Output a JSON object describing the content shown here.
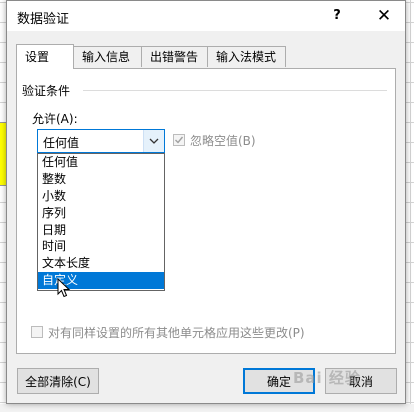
{
  "dialog": {
    "title": "数据验证",
    "help_label": "?",
    "close_label": "✕"
  },
  "tabs": [
    {
      "label": "设置",
      "active": true
    },
    {
      "label": "输入信息",
      "active": false
    },
    {
      "label": "出错警告",
      "active": false
    },
    {
      "label": "输入法模式",
      "active": false
    }
  ],
  "settings": {
    "group_label": "验证条件",
    "allow_label": "允许(A):",
    "allow_value": "任何值",
    "allow_options": [
      "任何值",
      "整数",
      "小数",
      "序列",
      "日期",
      "时间",
      "文本长度",
      "自定义"
    ],
    "selected_option": "自定义",
    "ignore_blank_label": "忽略空值(B)",
    "apply_all_label": "对有同样设置的所有其他单元格应用这些更改(P)"
  },
  "buttons": {
    "clear_all": "全部清除(C)",
    "ok": "确定",
    "cancel": "取消"
  },
  "watermark": "Bai 经验",
  "colors": {
    "accent": "#0078d7",
    "sheet_highlight": "#ffff00"
  }
}
